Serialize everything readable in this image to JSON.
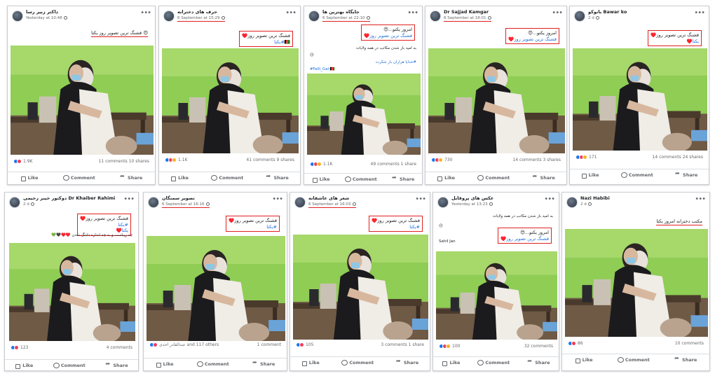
{
  "posts": [
    {
      "name": "داکتر زبیر رسا",
      "meta": "Yesterday at 10:48",
      "meta_highlight": false,
      "caption": {
        "text": "😍 قشنگ ترین تصویر روز یکتا",
        "style": "underline"
      },
      "reactions": "1.9K",
      "comments": "11 comments",
      "shares": "10 shares",
      "reaction_types": [
        "like",
        "love"
      ]
    },
    {
      "name": "حرف های دخترانه",
      "meta": "6 September at 15:29",
      "meta_highlight": true,
      "caption": {
        "line1": "قشنگ ترین تصویر روز♥️",
        "line2": "🇦🇫#یکتا",
        "style": "box"
      },
      "reactions": "1.1K",
      "comments": "41 comments",
      "shares": "9 shares",
      "reaction_types": [
        "like",
        "love",
        "haha"
      ]
    },
    {
      "name": "جایگاه بهترین ها",
      "meta": "6 September at 22:10",
      "meta_highlight": true,
      "caption": {
        "line1": "امروز یکتو...😍",
        "line2": "قشنگ ترین تصویر روز♥️",
        "style": "box"
      },
      "text_lines": [
        "به امید باز شدن مکاتب در همه ولایات",
        "😥",
        "#خدایا هزاران بار شکرت",
        "#Falli_Gal 🇦🇫"
      ],
      "reactions": "1.1K",
      "comments": "49 comments",
      "shares": "1 share",
      "reaction_types": [
        "like",
        "love",
        "haha"
      ]
    },
    {
      "name": "Dr Sajjad Kamgar",
      "meta": "6 September at 18:01",
      "meta_highlight": true,
      "caption": {
        "line1": "امروز یکتو...😍",
        "line2": "قشنگ ترین تصویر روز♥️",
        "style": "box"
      },
      "reactions": "730",
      "comments": "14 comments",
      "shares": "3 shares",
      "reaction_types": [
        "like",
        "love",
        "haha"
      ]
    },
    {
      "name": "بانوکو Bawar ko",
      "meta": "2 d",
      "meta_highlight": false,
      "caption": {
        "line1": "قشنگ ترین تصویر روز♥️",
        "line2": "یکتا♥️",
        "style": "box"
      },
      "reactions": "171",
      "comments": "14 comments",
      "shares": "24 shares",
      "reaction_types": [
        "like",
        "love",
        "haha"
      ]
    },
    {
      "name": "دوکتور خیبر رحیمی Dr Khaiber Rahimi",
      "meta": "2 d",
      "meta_highlight": false,
      "caption": {
        "line1": "قشنگ ترین تصویر روز♥️",
        "line2": "#یکتا",
        "line3": "یکتا♥️",
        "style": "box"
      },
      "text_lines": [
        "چه زیباست و به چه اندازه دلتنگ شدن ♥️♥️🖤💚"
      ],
      "reactions": "123",
      "comments": "4 comments",
      "shares": "",
      "reaction_types": [
        "like",
        "love"
      ]
    },
    {
      "name": "تصویر سمنگان",
      "meta": "6 September at 16:16",
      "meta_highlight": true,
      "caption": {
        "line1": "قشنگ ترین تصویر روز♥️",
        "line2": "#یکتا",
        "style": "box"
      },
      "reactions": "عبدالقادر احدی and 117 others",
      "comments": "1 comment",
      "shares": "",
      "reaction_types": [
        "like",
        "love"
      ]
    },
    {
      "name": "شعر های عاشقانه",
      "meta": "6 September at 16:03",
      "meta_highlight": true,
      "caption": {
        "line1": "قشنگ ترین تصویر روز♥️",
        "line2": "#یکتا",
        "style": "box"
      },
      "reactions": "105",
      "comments": "3 comments",
      "shares": "1 share",
      "reaction_types": [
        "like",
        "love"
      ]
    },
    {
      "name": "عکس های پروفایل",
      "meta": "Yesterday at 13:23",
      "meta_highlight": false,
      "caption": {
        "line1": "امروز یکتو...😍",
        "line2": "قشنگ ترین تصویر روز♥️",
        "style": "box"
      },
      "text_lines": [
        "به امید باز شدن مکاتب در همه ولایات",
        "😥",
        "Sahil Jan"
      ],
      "reactions": "100",
      "comments": "32 comments",
      "shares": "",
      "reaction_types": [
        "like",
        "love",
        "haha"
      ]
    },
    {
      "name": "Nazi Habibi",
      "meta": "2 d",
      "meta_highlight": false,
      "caption": {
        "text": "مکتب دخترانه امروز یکتا",
        "style": "underline"
      },
      "reactions": "86",
      "comments": "10 comments",
      "shares": "",
      "reaction_types": [
        "like",
        "love"
      ]
    }
  ],
  "actions": {
    "like": "Like",
    "comment": "Comment",
    "share": "Share"
  },
  "colors": {
    "highlight": "#e02020",
    "like": "#1877f2",
    "love": "#f33e58",
    "haha": "#f7b125",
    "wall": "#8fcd55",
    "link": "#216fdb"
  },
  "icons": {
    "more": "more-options-icon",
    "like": "thumbs-up-icon",
    "comment": "comment-bubble-icon",
    "share": "share-arrow-icon",
    "privacy": "globe-icon"
  }
}
